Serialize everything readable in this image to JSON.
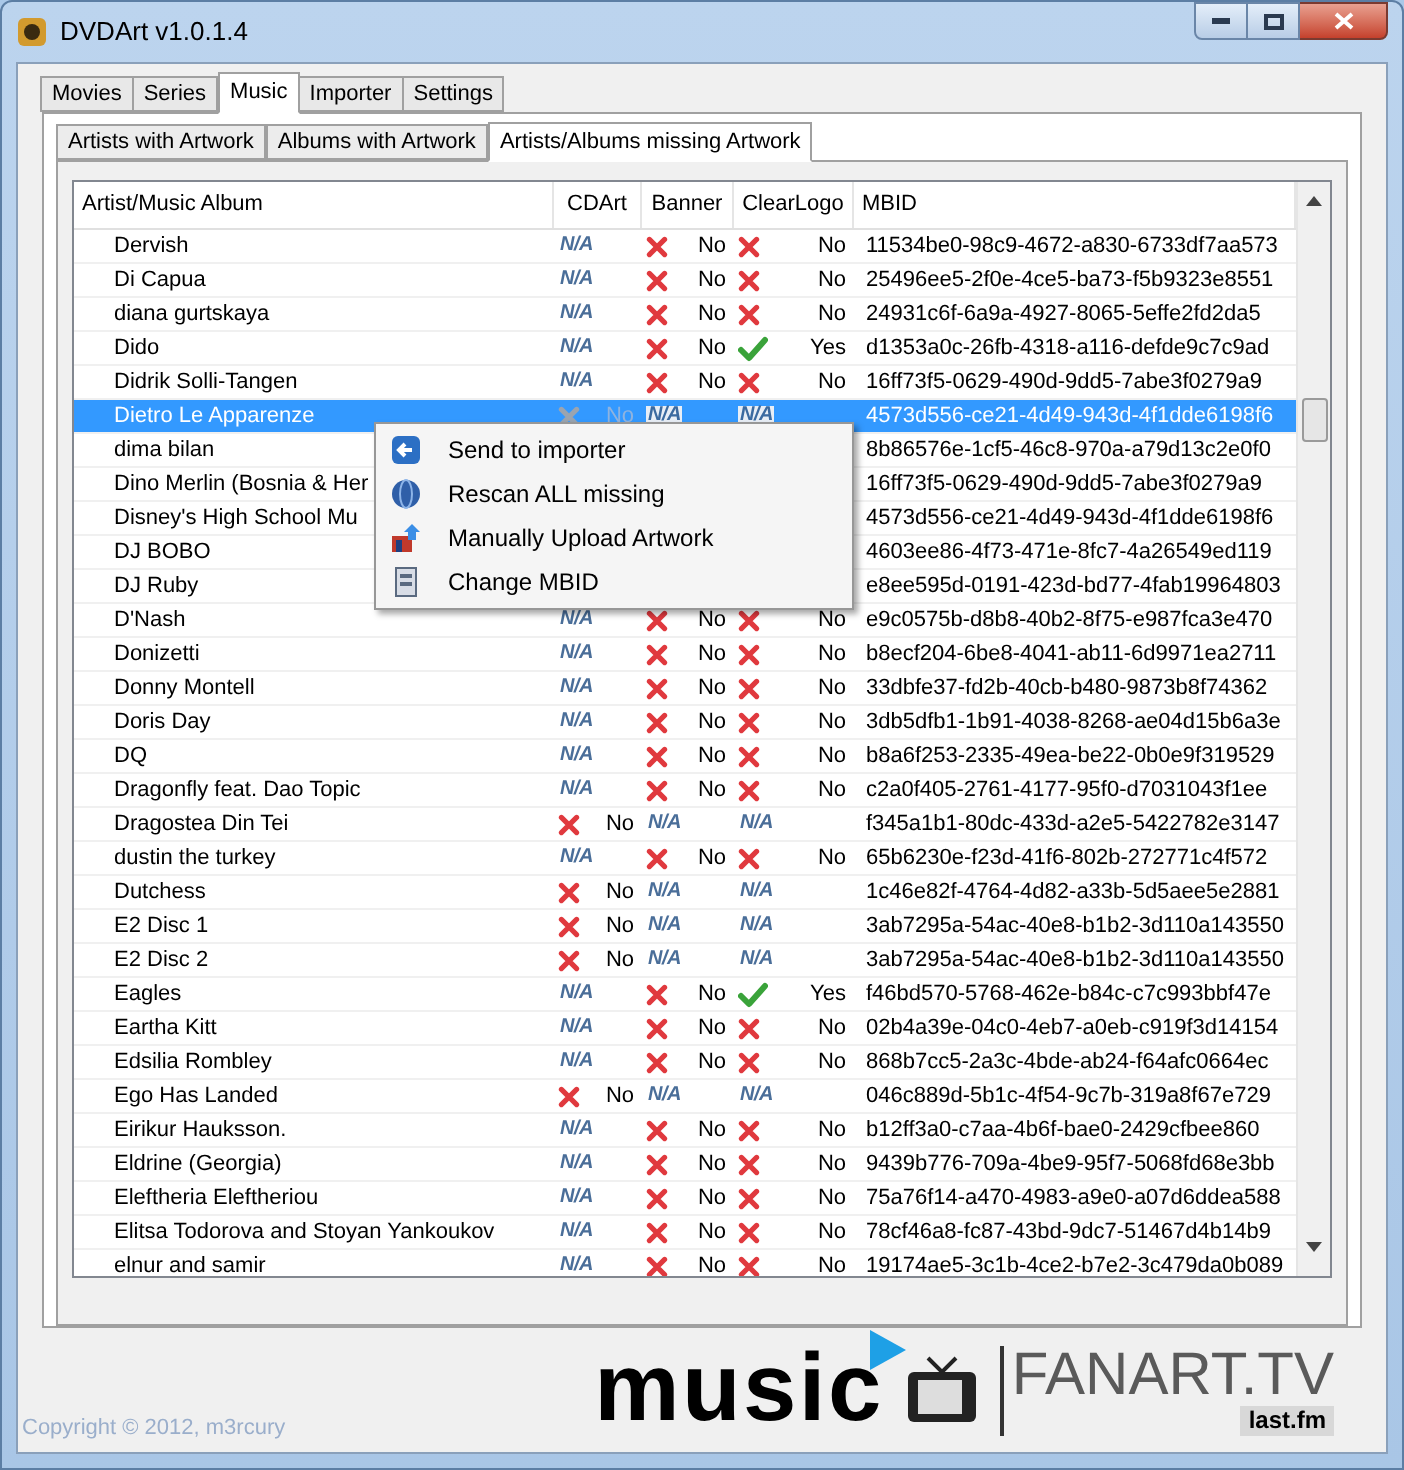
{
  "window": {
    "title": "DVDArt v1.0.1.4"
  },
  "tabs": [
    {
      "label": "Movies",
      "selected": false
    },
    {
      "label": "Series",
      "selected": false
    },
    {
      "label": "Music",
      "selected": true
    },
    {
      "label": "Importer",
      "selected": false
    },
    {
      "label": "Settings",
      "selected": false
    }
  ],
  "subtabs": [
    {
      "label": "Artists with Artwork",
      "selected": false
    },
    {
      "label": "Albums with Artwork",
      "selected": false
    },
    {
      "label": "Artists/Albums missing Artwork",
      "selected": true
    }
  ],
  "table": {
    "columns": [
      "Artist/Music Album",
      "CDArt",
      "Banner",
      "ClearLogo",
      "MBID"
    ],
    "rows": [
      {
        "name": "Dervish",
        "selected": false,
        "cdart": {
          "kind": "na",
          "text": "N/A"
        },
        "banner": {
          "kind": "no",
          "text": "No"
        },
        "clearlogo": {
          "kind": "no",
          "text": "No"
        },
        "mbid": "11534be0-98c9-4672-a830-6733df7aa573"
      },
      {
        "name": "Di Capua",
        "selected": false,
        "cdart": {
          "kind": "na",
          "text": "N/A"
        },
        "banner": {
          "kind": "no",
          "text": "No"
        },
        "clearlogo": {
          "kind": "no",
          "text": "No"
        },
        "mbid": "25496ee5-2f0e-4ce5-ba73-f5b9323e8551"
      },
      {
        "name": "diana gurtskaya",
        "selected": false,
        "cdart": {
          "kind": "na",
          "text": "N/A"
        },
        "banner": {
          "kind": "no",
          "text": "No"
        },
        "clearlogo": {
          "kind": "no",
          "text": "No"
        },
        "mbid": "24931c6f-6a9a-4927-8065-5effe2fd2da5"
      },
      {
        "name": "Dido",
        "selected": false,
        "cdart": {
          "kind": "na",
          "text": "N/A"
        },
        "banner": {
          "kind": "no",
          "text": "No"
        },
        "clearlogo": {
          "kind": "yes",
          "text": "Yes"
        },
        "mbid": "d1353a0c-26fb-4318-a116-defde9c7c9ad"
      },
      {
        "name": "Didrik Solli-Tangen",
        "selected": false,
        "cdart": {
          "kind": "na",
          "text": "N/A"
        },
        "banner": {
          "kind": "no",
          "text": "No"
        },
        "clearlogo": {
          "kind": "no",
          "text": "No"
        },
        "mbid": "16ff73f5-0629-490d-9dd5-7abe3f0279a9"
      },
      {
        "name": "Dietro Le Apparenze",
        "selected": true,
        "cdart": {
          "kind": "no",
          "text": "No"
        },
        "banner": {
          "kind": "na",
          "text": "N/A"
        },
        "clearlogo": {
          "kind": "na",
          "text": "N/A"
        },
        "mbid": "4573d556-ce21-4d49-943d-4f1dde6198f6"
      },
      {
        "name": "dima bilan",
        "selected": false,
        "mbid": "8b86576e-1cf5-46c8-970a-a79d13c2e0f0"
      },
      {
        "name": "Dino Merlin (Bosnia & Her",
        "selected": false,
        "mbid": "16ff73f5-0629-490d-9dd5-7abe3f0279a9"
      },
      {
        "name": "Disney's High School Mu",
        "selected": false,
        "mbid": "4573d556-ce21-4d49-943d-4f1dde6198f6"
      },
      {
        "name": "DJ BOBO",
        "selected": false,
        "mbid": "4603ee86-4f73-471e-8fc7-4a26549ed119"
      },
      {
        "name": "DJ Ruby",
        "selected": false,
        "mbid": "e8ee595d-0191-423d-bd77-4fab19964803"
      },
      {
        "name": "D'Nash",
        "selected": false,
        "cdart": {
          "kind": "na",
          "text": "N/A"
        },
        "banner": {
          "kind": "no",
          "text": "No"
        },
        "clearlogo": {
          "kind": "no",
          "text": "No"
        },
        "mbid": "e9c0575b-d8b8-40b2-8f75-e987fca3e470"
      },
      {
        "name": "Donizetti",
        "selected": false,
        "cdart": {
          "kind": "na",
          "text": "N/A"
        },
        "banner": {
          "kind": "no",
          "text": "No"
        },
        "clearlogo": {
          "kind": "no",
          "text": "No"
        },
        "mbid": "b8ecf204-6be8-4041-ab11-6d9971ea2711"
      },
      {
        "name": "Donny Montell",
        "selected": false,
        "cdart": {
          "kind": "na",
          "text": "N/A"
        },
        "banner": {
          "kind": "no",
          "text": "No"
        },
        "clearlogo": {
          "kind": "no",
          "text": "No"
        },
        "mbid": "33dbfe37-fd2b-40cb-b480-9873b8f74362"
      },
      {
        "name": "Doris Day",
        "selected": false,
        "cdart": {
          "kind": "na",
          "text": "N/A"
        },
        "banner": {
          "kind": "no",
          "text": "No"
        },
        "clearlogo": {
          "kind": "no",
          "text": "No"
        },
        "mbid": "3db5dfb1-1b91-4038-8268-ae04d15b6a3e"
      },
      {
        "name": "DQ",
        "selected": false,
        "cdart": {
          "kind": "na",
          "text": "N/A"
        },
        "banner": {
          "kind": "no",
          "text": "No"
        },
        "clearlogo": {
          "kind": "no",
          "text": "No"
        },
        "mbid": "b8a6f253-2335-49ea-be22-0b0e9f319529"
      },
      {
        "name": "Dragonfly feat. Dao Topic",
        "selected": false,
        "cdart": {
          "kind": "na",
          "text": "N/A"
        },
        "banner": {
          "kind": "no",
          "text": "No"
        },
        "clearlogo": {
          "kind": "no",
          "text": "No"
        },
        "mbid": "c2a0f405-2761-4177-95f0-d7031043f1ee"
      },
      {
        "name": "Dragostea Din Tei",
        "selected": false,
        "cdart": {
          "kind": "no",
          "text": "No"
        },
        "banner": {
          "kind": "na",
          "text": "N/A"
        },
        "clearlogo": {
          "kind": "na",
          "text": "N/A"
        },
        "mbid": "f345a1b1-80dc-433d-a2e5-5422782e3147"
      },
      {
        "name": "dustin the turkey",
        "selected": false,
        "cdart": {
          "kind": "na",
          "text": "N/A"
        },
        "banner": {
          "kind": "no",
          "text": "No"
        },
        "clearlogo": {
          "kind": "no",
          "text": "No"
        },
        "mbid": "65b6230e-f23d-41f6-802b-272771c4f572"
      },
      {
        "name": "Dutchess",
        "selected": false,
        "cdart": {
          "kind": "no",
          "text": "No"
        },
        "banner": {
          "kind": "na",
          "text": "N/A"
        },
        "clearlogo": {
          "kind": "na",
          "text": "N/A"
        },
        "mbid": "1c46e82f-4764-4d82-a33b-5d5aee5e2881"
      },
      {
        "name": "E2 Disc 1",
        "selected": false,
        "cdart": {
          "kind": "no",
          "text": "No"
        },
        "banner": {
          "kind": "na",
          "text": "N/A"
        },
        "clearlogo": {
          "kind": "na",
          "text": "N/A"
        },
        "mbid": "3ab7295a-54ac-40e8-b1b2-3d110a143550"
      },
      {
        "name": "E2 Disc 2",
        "selected": false,
        "cdart": {
          "kind": "no",
          "text": "No"
        },
        "banner": {
          "kind": "na",
          "text": "N/A"
        },
        "clearlogo": {
          "kind": "na",
          "text": "N/A"
        },
        "mbid": "3ab7295a-54ac-40e8-b1b2-3d110a143550"
      },
      {
        "name": "Eagles",
        "selected": false,
        "cdart": {
          "kind": "na",
          "text": "N/A"
        },
        "banner": {
          "kind": "no",
          "text": "No"
        },
        "clearlogo": {
          "kind": "yes",
          "text": "Yes"
        },
        "mbid": "f46bd570-5768-462e-b84c-c7c993bbf47e"
      },
      {
        "name": "Eartha Kitt",
        "selected": false,
        "cdart": {
          "kind": "na",
          "text": "N/A"
        },
        "banner": {
          "kind": "no",
          "text": "No"
        },
        "clearlogo": {
          "kind": "no",
          "text": "No"
        },
        "mbid": "02b4a39e-04c0-4eb7-a0eb-c919f3d14154"
      },
      {
        "name": "Edsilia Rombley",
        "selected": false,
        "cdart": {
          "kind": "na",
          "text": "N/A"
        },
        "banner": {
          "kind": "no",
          "text": "No"
        },
        "clearlogo": {
          "kind": "no",
          "text": "No"
        },
        "mbid": "868b7cc5-2a3c-4bde-ab24-f64afc0664ec"
      },
      {
        "name": "Ego Has Landed",
        "selected": false,
        "cdart": {
          "kind": "no",
          "text": "No"
        },
        "banner": {
          "kind": "na",
          "text": "N/A"
        },
        "clearlogo": {
          "kind": "na",
          "text": "N/A"
        },
        "mbid": "046c889d-5b1c-4f54-9c7b-319a8f67e729"
      },
      {
        "name": "Eirikur Hauksson.",
        "selected": false,
        "cdart": {
          "kind": "na",
          "text": "N/A"
        },
        "banner": {
          "kind": "no",
          "text": "No"
        },
        "clearlogo": {
          "kind": "no",
          "text": "No"
        },
        "mbid": "b12ff3a0-c7aa-4b6f-bae0-2429cfbee860"
      },
      {
        "name": "Eldrine (Georgia)",
        "selected": false,
        "cdart": {
          "kind": "na",
          "text": "N/A"
        },
        "banner": {
          "kind": "no",
          "text": "No"
        },
        "clearlogo": {
          "kind": "no",
          "text": "No"
        },
        "mbid": "9439b776-709a-4be9-95f7-5068fd68e3bb"
      },
      {
        "name": "Eleftheria Eleftheriou",
        "selected": false,
        "cdart": {
          "kind": "na",
          "text": "N/A"
        },
        "banner": {
          "kind": "no",
          "text": "No"
        },
        "clearlogo": {
          "kind": "no",
          "text": "No"
        },
        "mbid": "75a76f14-a470-4983-a9e0-a07d6ddea588"
      },
      {
        "name": "Elitsa Todorova and Stoyan Yankoukov",
        "selected": false,
        "cdart": {
          "kind": "na",
          "text": "N/A"
        },
        "banner": {
          "kind": "no",
          "text": "No"
        },
        "clearlogo": {
          "kind": "no",
          "text": "No"
        },
        "mbid": "78cf46a8-fc87-43bd-9dc7-51467d4b14b9"
      },
      {
        "name": "elnur and samir",
        "selected": false,
        "cdart": {
          "kind": "na",
          "text": "N/A"
        },
        "banner": {
          "kind": "no",
          "text": "No"
        },
        "clearlogo": {
          "kind": "no",
          "text": "No"
        },
        "mbid": "19174ae5-3c1b-4ce2-b7e2-3c479da0b089"
      }
    ]
  },
  "context_menu": {
    "items": [
      {
        "label": "Send to importer"
      },
      {
        "label": "Rescan ALL missing"
      },
      {
        "label": "Manually Upload Artwork"
      },
      {
        "label": "Change MBID"
      }
    ]
  },
  "logo": {
    "music": "music",
    "fanart": "FANART.TV",
    "lastfm": "last.fm"
  },
  "status_bar": {
    "copyright": "Copyright © 2012, m3rcury"
  }
}
